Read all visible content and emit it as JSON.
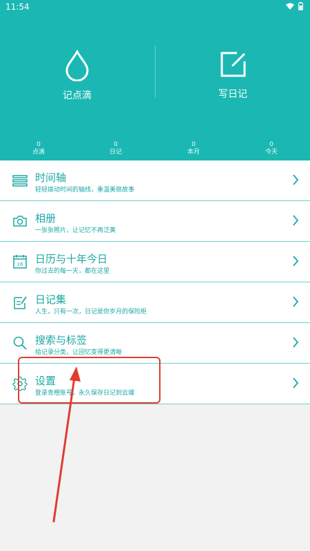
{
  "status_bar": {
    "time": "11:54",
    "icons": [
      "wifi-icon",
      "battery-icon"
    ]
  },
  "header": {
    "actions": [
      {
        "label": "记点滴",
        "icon": "drop-icon"
      },
      {
        "label": "写日记",
        "icon": "edit-icon"
      }
    ],
    "stats": [
      {
        "value": "0",
        "label": "点滴"
      },
      {
        "value": "0",
        "label": "日记"
      },
      {
        "value": "0",
        "label": "本月"
      },
      {
        "value": "0",
        "label": "今天"
      }
    ],
    "color": "#1bb8b3"
  },
  "menu": [
    {
      "title": "时间轴",
      "subtitle": "轻轻拨动时间的轴线，重温美丽故事",
      "icon": "timeline-icon"
    },
    {
      "title": "相册",
      "subtitle": "一张张照片，让记忆不再泛黄",
      "icon": "camera-icon"
    },
    {
      "title": "日历与十年今日",
      "subtitle": "你过去的每一天，都在这里",
      "icon": "calendar-icon",
      "calendar_day": "16"
    },
    {
      "title": "日记集",
      "subtitle": "人生，只有一次，日记是你岁月的保险柜",
      "icon": "notebook-icon"
    },
    {
      "title": "搜索与标签",
      "subtitle": "给记录分类，让回忆变得更清晰",
      "icon": "search-icon"
    },
    {
      "title": "设置",
      "subtitle": "登录青橙账号，永久保存日记到云端",
      "icon": "gear-icon"
    }
  ],
  "annotation_color": "#e03c2f"
}
